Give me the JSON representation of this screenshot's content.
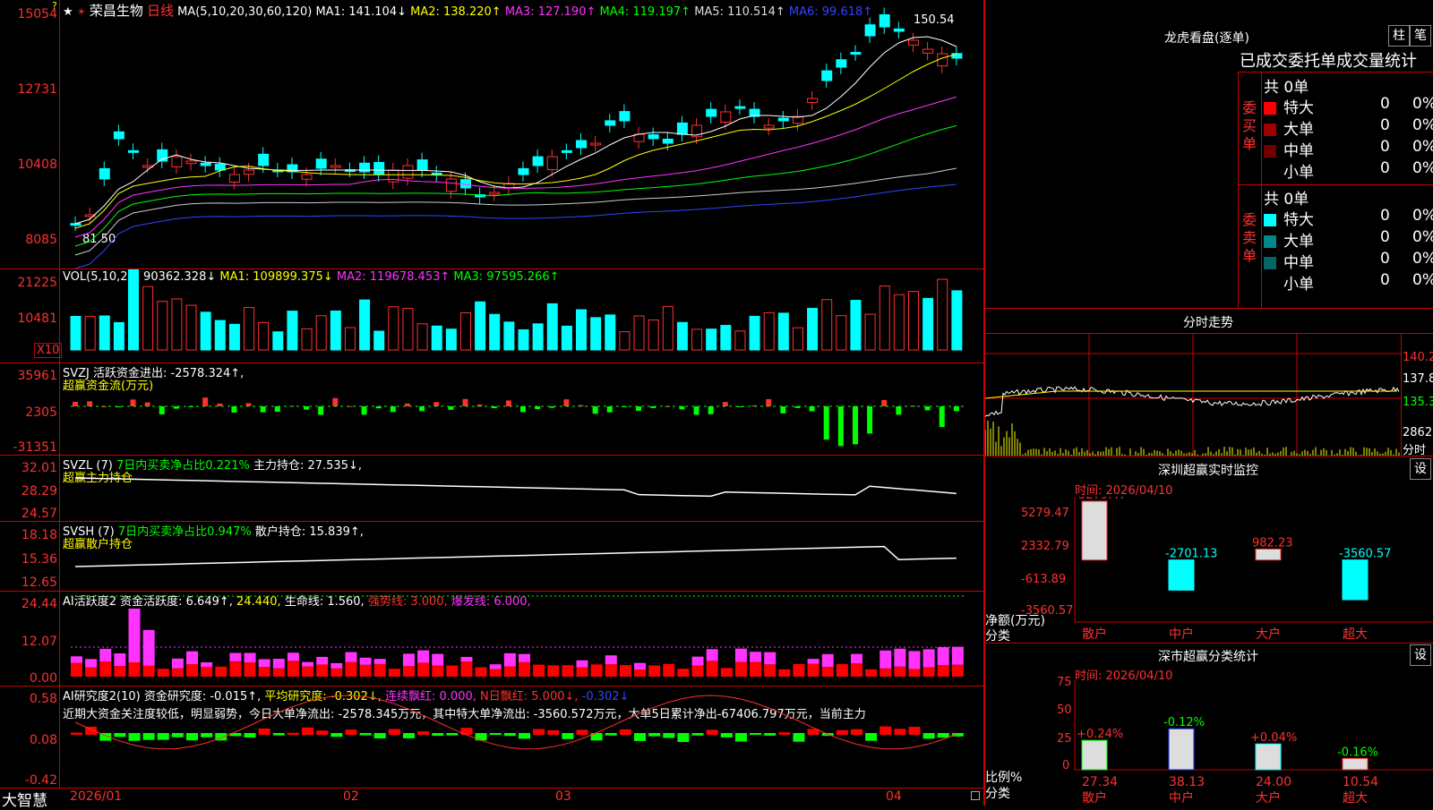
{
  "stock": {
    "name": "荣昌生物",
    "period": "日线",
    "star": "★"
  },
  "ma_line": {
    "label": "MA(5,10,20,30,60,120)",
    "ma1": "MA1: 141.104↓",
    "ma2": "MA2: 138.220↑",
    "ma3": "MA3: 127.190↑",
    "ma4": "MA4: 119.197↑",
    "ma5": "MA5: 110.514↑",
    "ma6": "MA6: 99.618↑"
  },
  "price_axis": [
    "15054",
    "12731",
    "10408",
    "8085"
  ],
  "price_marks": {
    "high": "150.54",
    "low": "81.50"
  },
  "vol": {
    "label": "VOL(5,10,20)",
    "val": "90362.328↓",
    "ma1": "MA1: 109899.375↓",
    "ma2": "MA2: 119678.453↑",
    "ma3": "MA3: 97595.266↑",
    "axis": [
      "21225",
      "10481"
    ],
    "unit": "X10"
  },
  "svzj": {
    "label": "SVZJ",
    "desc": "活跃资金进出: -2578.324↑,",
    "sub": "超赢资金流(万元)",
    "axis": [
      "35961",
      "2305",
      "-31351"
    ]
  },
  "svzl": {
    "label": "SVZL (7)",
    "desc1": "7日内买卖净占比0.221%",
    "desc2": "主力持仓: 27.535↓,",
    "sub": "超赢主力持仓",
    "axis": [
      "32.01",
      "28.29",
      "24.57"
    ]
  },
  "svsh": {
    "label": "SVSH (7)",
    "desc1": "7日内买卖净占比0.947%",
    "desc2": "散户持仓: 15.839↑,",
    "sub": "超赢散户持仓",
    "axis": [
      "18.18",
      "15.36",
      "12.65"
    ]
  },
  "ai2": {
    "label": "AI活跃度2",
    "a": "资金活跃度: 6.649↑,",
    "b": "24.440,",
    "c": "生命线: 1.560,",
    "d": "强势线: 3.000,",
    "e": "爆发线: 6.000,",
    "axis": [
      "24.44",
      "12.07",
      "0.00"
    ]
  },
  "ai_research": {
    "label": "AI研究度2(10)",
    "a": "资金研究度: -0.015↑,",
    "b": "平均研究度: -0.302↓,",
    "c": "连续飘红: 0.000,",
    "d": "N日飘红: 5.000↓,",
    "e": "-0.302↓",
    "note": "近期大资金关注度较低，明显弱势，今日大单净流出: -2578.345万元，其中特大单净流出: -3560.572万元，大单5日累计净出-67406.797万元，当前主力",
    "axis": [
      "0.58",
      "0.08",
      "-0.42"
    ]
  },
  "xaxis": [
    "2026/01",
    "02",
    "03",
    "04"
  ],
  "brand": "大智慧",
  "lhb": {
    "title": "龙虎看盘(逐单)",
    "btn1": "柱",
    "btn2": "笔",
    "tabs_header": "已成交委托单成交量统计",
    "buy": {
      "side": "委买单",
      "total": "共 0单",
      "rows": [
        {
          "name": "特大",
          "v": "0",
          "p": "0%",
          "color": "#ff0000"
        },
        {
          "name": "大单",
          "v": "0",
          "p": "0%",
          "color": "#a00000"
        },
        {
          "name": "中单",
          "v": "0",
          "p": "0%",
          "color": "#700000"
        },
        {
          "name": "小单",
          "v": "0",
          "p": "0%",
          "color": "#000000"
        }
      ]
    },
    "sell": {
      "side": "委卖单",
      "total": "共 0单",
      "rows": [
        {
          "name": "特大",
          "v": "0",
          "p": "0%",
          "color": "#00ffff"
        },
        {
          "name": "大单",
          "v": "0",
          "p": "0%",
          "color": "#008888"
        },
        {
          "name": "中单",
          "v": "0",
          "p": "0%",
          "color": "#006666"
        },
        {
          "name": "小单",
          "v": "0",
          "p": "0%",
          "color": "#000000"
        }
      ]
    }
  },
  "fenshi": {
    "title": "分时走势",
    "axis": [
      "140.2",
      "137.8",
      "135.3"
    ],
    "vol": "2862",
    "vol_label": "分时"
  },
  "sz_monitor": {
    "title": "深圳超赢实时监控",
    "btn": "设",
    "time": "时间: 2026/04/10",
    "axis": [
      "5279.47",
      "2332.79",
      "-613.89",
      "-3560.57"
    ],
    "unit": "净额(万元)",
    "cls": "分类",
    "bars": [
      {
        "name": "散户",
        "value": 5279.47,
        "label": "5279.47"
      },
      {
        "name": "中户",
        "value": -2701.13,
        "label": "-2701.13"
      },
      {
        "name": "大户",
        "value": 982.23,
        "label": "982.23"
      },
      {
        "name": "超大",
        "value": -3560.57,
        "label": "-3560.57"
      }
    ]
  },
  "sz_class": {
    "title": "深市超赢分类统计",
    "btn": "设",
    "time": "时间: 2026/04/10",
    "axis": [
      "75",
      "50",
      "25",
      "0"
    ],
    "unit": "比例%",
    "cls": "分类",
    "bars": [
      {
        "name": "散户",
        "value": 27.34,
        "label": "27.34",
        "chg": "+0.24%"
      },
      {
        "name": "中户",
        "value": 38.13,
        "label": "38.13",
        "chg": "-0.12%"
      },
      {
        "name": "大户",
        "value": 24.0,
        "label": "24.00",
        "chg": "+0.04%"
      },
      {
        "name": "超大",
        "value": 10.54,
        "label": "10.54",
        "chg": "-0.16%"
      }
    ]
  },
  "colors": {
    "up": "#ff3030",
    "down": "#00ffff",
    "bg": "#000000",
    "grid": "#c00000"
  }
}
